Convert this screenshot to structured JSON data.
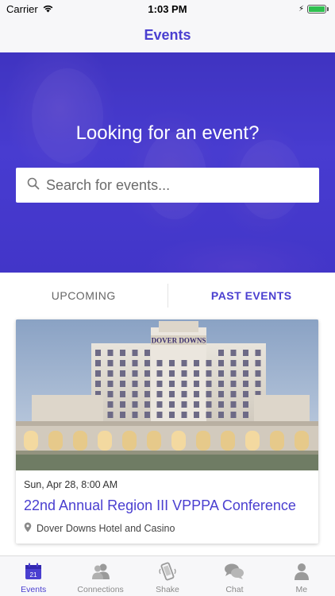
{
  "status_bar": {
    "carrier": "Carrier",
    "time": "1:03 PM",
    "battery_level": 1.0,
    "battery_color": "#2ec04f"
  },
  "nav": {
    "title": "Events"
  },
  "hero": {
    "title": "Looking for an event?",
    "search_placeholder": "Search for events..."
  },
  "tabs": {
    "upcoming": "UPCOMING",
    "past": "PAST EVENTS",
    "active": "past"
  },
  "event": {
    "image_sign": "DOVER DOWNS",
    "date": "Sun, Apr 28, 8:00 AM",
    "title": "22nd Annual Region III VPPPA Conference",
    "location": "Dover Downs Hotel and Casino"
  },
  "tab_bar": {
    "calendar_day": "21",
    "items": [
      {
        "label": "Events",
        "icon": "calendar-icon",
        "active": true
      },
      {
        "label": "Connections",
        "icon": "people-icon",
        "active": false
      },
      {
        "label": "Shake",
        "icon": "shake-phone-icon",
        "active": false
      },
      {
        "label": "Chat",
        "icon": "chat-bubbles-icon",
        "active": false
      },
      {
        "label": "Me",
        "icon": "person-icon",
        "active": false
      }
    ]
  },
  "colors": {
    "accent": "#4a3fd0",
    "hero_overlay": "#4a3fd0",
    "inactive": "#8a8a8a"
  }
}
